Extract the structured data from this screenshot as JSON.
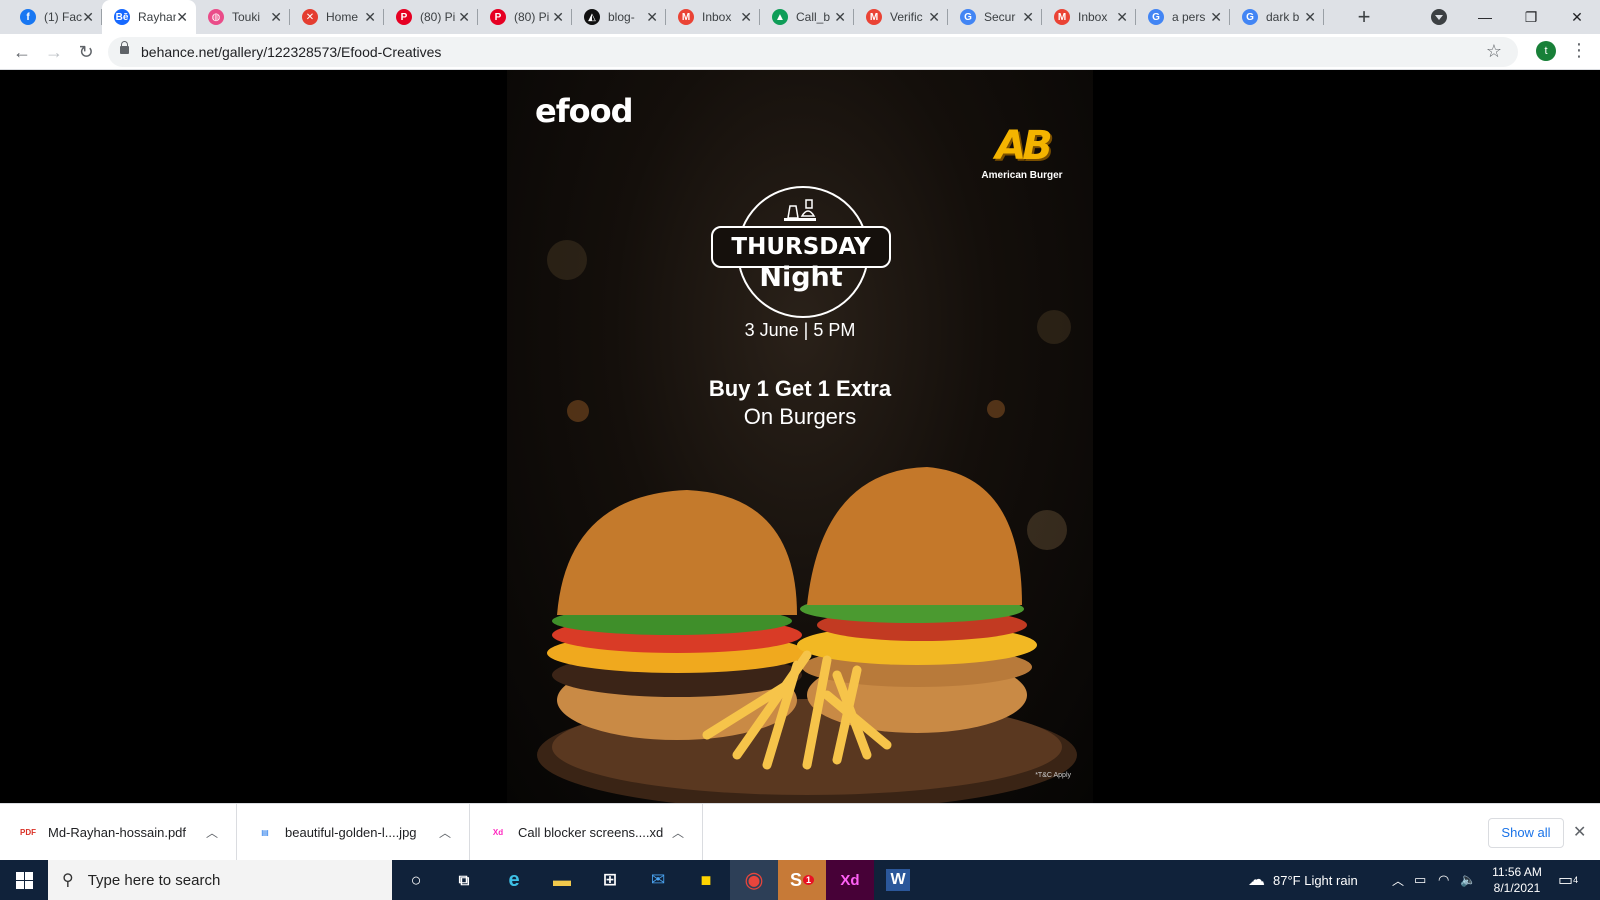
{
  "browser": {
    "tabs": [
      {
        "title": "(1) Fac",
        "icon": "facebook-icon",
        "color": "#1877f2",
        "glyph": "f",
        "active": false
      },
      {
        "title": "Rayhan",
        "icon": "behance-icon",
        "color": "#1769ff",
        "glyph": "Bē",
        "active": true
      },
      {
        "title": "Touki",
        "icon": "dribbble-icon",
        "color": "#ea4c89",
        "glyph": "◍",
        "active": false
      },
      {
        "title": "Home",
        "icon": "home-site-icon",
        "color": "#e43d30",
        "glyph": "✕",
        "active": false
      },
      {
        "title": "(80) Pi",
        "icon": "pinterest-icon",
        "color": "#e60023",
        "glyph": "P",
        "active": false
      },
      {
        "title": "(80) Pi",
        "icon": "pinterest-icon",
        "color": "#e60023",
        "glyph": "P",
        "active": false
      },
      {
        "title": "blog-",
        "icon": "blog-icon",
        "color": "#111111",
        "glyph": "◭",
        "active": false
      },
      {
        "title": "Inbox",
        "icon": "gmail-icon",
        "color": "#ea4335",
        "glyph": "M",
        "active": false
      },
      {
        "title": "Call_b",
        "icon": "google-drive-icon",
        "color": "#0f9d58",
        "glyph": "▲",
        "active": false
      },
      {
        "title": "Verific",
        "icon": "gmail-icon",
        "color": "#ea4335",
        "glyph": "M",
        "active": false
      },
      {
        "title": "Secur",
        "icon": "google-icon",
        "color": "#4285f4",
        "glyph": "G",
        "active": false
      },
      {
        "title": "Inbox",
        "icon": "gmail-icon",
        "color": "#ea4335",
        "glyph": "M",
        "active": false
      },
      {
        "title": "a pers",
        "icon": "google-icon",
        "color": "#4285f4",
        "glyph": "G",
        "active": false
      },
      {
        "title": "dark b",
        "icon": "google-icon",
        "color": "#4285f4",
        "glyph": "G",
        "active": false
      }
    ],
    "url": "behance.net/gallery/122328573/Efood-Creatives",
    "profile_initial": "t"
  },
  "poster": {
    "brand": "efood",
    "partner_mark": "AB",
    "partner_name": "American Burger",
    "badge_line1": "THURSDAY",
    "badge_line2": "Night",
    "date": "3 June | 5 PM",
    "offer_line1": "Buy 1 Get 1 Extra",
    "offer_line2": "On Burgers",
    "fine_print": "*T&C Apply"
  },
  "downloads": {
    "items": [
      {
        "name": "Md-Rayhan-hossain.pdf",
        "icon": "pdf-file-icon",
        "glyph": "PDF",
        "color": "#d93025"
      },
      {
        "name": "beautiful-golden-l....jpg",
        "icon": "image-file-icon",
        "glyph": "▤",
        "color": "#1a73e8"
      },
      {
        "name": "Call blocker screens....xd",
        "icon": "xd-file-icon",
        "glyph": "Xd",
        "color": "#ff26be"
      }
    ],
    "show_all": "Show all"
  },
  "taskbar": {
    "search_placeholder": "Type here to search",
    "weather": "87°F  Light rain",
    "time": "11:56 AM",
    "date": "8/1/2021",
    "notification_count": "4",
    "skype_badge": "1"
  }
}
